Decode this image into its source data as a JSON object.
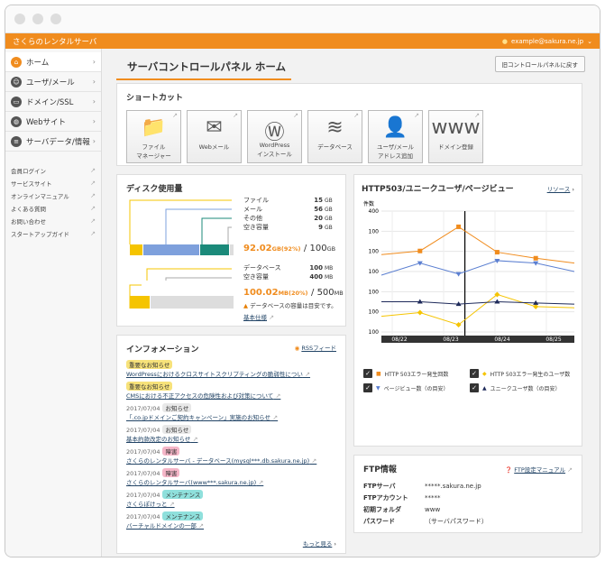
{
  "topbar": {
    "title": "さくらのレンタルサーバ",
    "user": "example@sakura.ne.jp"
  },
  "sidebar": {
    "items": [
      {
        "label": "ホーム",
        "icon": "home-icon"
      },
      {
        "label": "ユーザ/メール",
        "icon": "user-icon"
      },
      {
        "label": "ドメイン/SSL",
        "icon": "card-icon"
      },
      {
        "label": "Webサイト",
        "icon": "globe-icon"
      },
      {
        "label": "サーバデータ/情報",
        "icon": "server-icon"
      }
    ],
    "links": [
      "会員ログイン",
      "サービスサイト",
      "オンラインマニュアル",
      "よくある質問",
      "お問い合わせ",
      "スタートアップガイド"
    ]
  },
  "page": {
    "title": "サーバコントロールパネル ホーム",
    "old_btn": "旧コントロールパネルに戻す"
  },
  "shortcut": {
    "title": "ショートカット",
    "items": [
      {
        "l1": "ファイル",
        "l2": "マネージャー",
        "glyph": "📁"
      },
      {
        "l1": "Webメール",
        "l2": "",
        "glyph": "✉"
      },
      {
        "l1": "WordPress",
        "l2": "インストール",
        "glyph": "Ⓦ"
      },
      {
        "l1": "データベース",
        "l2": "",
        "glyph": "≋"
      },
      {
        "l1": "ユーザ/メール",
        "l2": "アドレス追加",
        "glyph": "👤"
      },
      {
        "l1": "ドメイン登録",
        "l2": "",
        "glyph": "www"
      }
    ]
  },
  "disk": {
    "title": "ディスク使用量",
    "rows": [
      {
        "label": "ファイル",
        "num": "15",
        "unit": "GB"
      },
      {
        "label": "メール",
        "num": "56",
        "unit": "GB"
      },
      {
        "label": "その他",
        "num": "20",
        "unit": "GB"
      },
      {
        "label": "空き容量",
        "num": "9",
        "unit": "GB"
      }
    ],
    "total_used": "92.02",
    "total_pct": "GB(92%)",
    "total_sep": "/ 100",
    "total_unit": "GB",
    "db_rows": [
      {
        "label": "データベース",
        "num": "100",
        "unit": "MB"
      },
      {
        "label": "空き容量",
        "num": "400",
        "unit": "MB"
      }
    ],
    "db_used": "100.02",
    "db_pct": "MB(20%)",
    "db_sep": "/ 500",
    "db_unit": "MB",
    "db_note": "データベースの容量は目安です。",
    "spec_link": "基本仕様",
    "bar_fractions": {
      "file": 0.15,
      "mail": 0.56,
      "other": 0.2,
      "free": 0.09,
      "db": 0.2
    },
    "colors": {
      "file": "#f5c400",
      "mail": "#7ea0dc",
      "other": "#1b8a7a",
      "free": "#dddddd"
    }
  },
  "info": {
    "title": "インフォメーション",
    "rss": "RSSフィード",
    "more": "もっと見る",
    "items": [
      {
        "date": "",
        "tag": "重要なお知らせ",
        "tagcolor": "#f7e27a",
        "text": "WordPressにおけるクロスサイトスクリプティングの脆弱性につい"
      },
      {
        "date": "",
        "tag": "重要なお知らせ",
        "tagcolor": "#f7e27a",
        "text": "CMSにおける不正アクセスの危険性および対策について"
      },
      {
        "date": "2017/07/04",
        "tag": "お知らせ",
        "tagcolor": "#e8e8e8",
        "text": "「.co.jpドメインご契約キャンペーン」実施のお知らせ"
      },
      {
        "date": "2017/07/04",
        "tag": "お知らせ",
        "tagcolor": "#e8e8e8",
        "text": "基本約款改定のお知らせ"
      },
      {
        "date": "2017/07/04",
        "tag": "障害",
        "tagcolor": "#f5b6c8",
        "text": "さくらのレンタルサーバ - データベース(mysql***.db.sakura.ne.jp)"
      },
      {
        "date": "2017/07/04",
        "tag": "障害",
        "tagcolor": "#f5b6c8",
        "text": "さくらのレンタルサーバ(www***.sakura.ne.jp)"
      },
      {
        "date": "2017/07/04",
        "tag": "メンテナンス",
        "tagcolor": "#8fe0dc",
        "text": "さくらぽけっと"
      },
      {
        "date": "2017/07/04",
        "tag": "メンテナンス",
        "tagcolor": "#8fe0dc",
        "text": "バーチャルドメインの一部"
      }
    ]
  },
  "http": {
    "title": "HTTP503/ユニークユーザ/ページビュー",
    "link": "リソース",
    "ylabel": "件数",
    "yticks": [
      "400",
      "100",
      "100",
      "100",
      "100",
      "100",
      "100"
    ],
    "xticks": [
      "08/22",
      "08/23",
      "08/24",
      "08/25"
    ],
    "legend": [
      {
        "label": "HTTP 503エラー発生回数",
        "color": "#f08c1e",
        "marker": "■"
      },
      {
        "label": "HTTP 503エラー発生のユーザ数",
        "color": "#f5c400",
        "marker": "◆"
      },
      {
        "label": "ページビュー数（の目安）",
        "color": "#5b7fd1",
        "marker": "▼"
      },
      {
        "label": "ユニークユーザ数（の目安）",
        "color": "#1e2a5a",
        "marker": "▲"
      }
    ]
  },
  "chart_data": {
    "type": "line",
    "x": [
      0,
      1,
      2,
      3,
      4,
      5
    ],
    "xticks": [
      "08/22",
      "08/23",
      "08/24",
      "08/25"
    ],
    "series": [
      {
        "name": "HTTP 503エラー発生回数",
        "color": "#f08c1e",
        "values": [
          0.64,
          0.67,
          0.87,
          0.66,
          0.61,
          0.57
        ]
      },
      {
        "name": "HTTP 503エラー発生のユーザ数",
        "color": "#f5c400",
        "values": [
          0.13,
          0.16,
          0.06,
          0.31,
          0.21,
          0.2
        ]
      },
      {
        "name": "ページビュー数（の目安）",
        "color": "#5b7fd1",
        "values": [
          0.47,
          0.57,
          0.48,
          0.59,
          0.57,
          0.5
        ]
      },
      {
        "name": "ユニークユーザ数（の目安）",
        "color": "#1e2a5a",
        "values": [
          0.25,
          0.25,
          0.23,
          0.25,
          0.24,
          0.23
        ]
      }
    ]
  },
  "ftp": {
    "title": "FTP情報",
    "manual": "FTP設定マニュアル",
    "rows": [
      {
        "k": "FTPサーバ",
        "v": "*****.sakura.ne.jp"
      },
      {
        "k": "FTPアカウント",
        "v": "*****"
      },
      {
        "k": "初期フォルダ",
        "v": "www"
      },
      {
        "k": "パスワード",
        "v": "（サーバパスワード）"
      }
    ]
  }
}
